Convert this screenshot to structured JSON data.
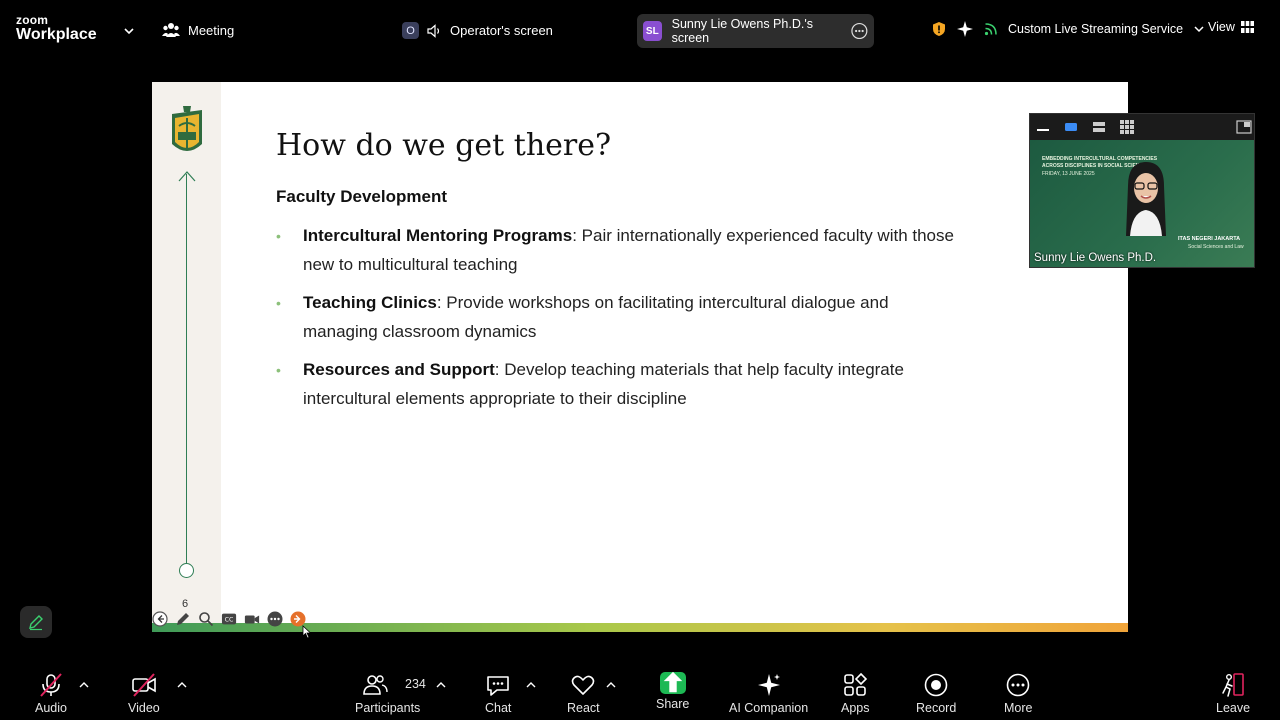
{
  "app": {
    "logo_line1": "zoom",
    "logo_line2": "Workplace"
  },
  "topbar": {
    "meeting_label": "Meeting",
    "operator_badge": "O",
    "operator_label": "Operator's screen",
    "speaker_badge": "SL",
    "speaker_label": "Sunny Lie Owens Ph.D.'s screen",
    "streaming_label": "Custom Live Streaming Service",
    "view_label": "View"
  },
  "slide": {
    "title": "How do we get there?",
    "section": "Faculty Development",
    "bullets": [
      {
        "bold": "Intercultural Mentoring Programs",
        "text": ": Pair internationally experienced faculty with those new to multicultural teaching"
      },
      {
        "bold": "Teaching Clinics",
        "text": ": Provide workshops on facilitating intercultural dialogue and managing classroom dynamics"
      },
      {
        "bold": "Resources and Support",
        "text": ": Develop teaching materials that help faculty integrate intercultural elements appropriate to their discipline"
      }
    ],
    "page_number": "6"
  },
  "thumbnail": {
    "name": "Sunny Lie Owens Ph.D.",
    "banner_line1": "EMBEDDING INTERCULTURAL COMPETENCIES",
    "banner_line2": "ACROSS DISCIPLINES IN SOCIAL SCIENCES",
    "banner_date": "FRIDAY, 13 JUNE 2025",
    "banner_univ": "ITAS NEGERI JAKARTA",
    "banner_faculty": "Social Sciences and Law"
  },
  "bottombar": {
    "audio": "Audio",
    "video": "Video",
    "participants": "Participants",
    "participants_count": "234",
    "chat": "Chat",
    "react": "React",
    "share": "Share",
    "ai_companion": "AI Companion",
    "apps": "Apps",
    "record": "Record",
    "more": "More",
    "leave": "Leave"
  },
  "colors": {
    "accent_green": "#2f7e55",
    "share_green": "#1db954",
    "muted_red": "#e0245e"
  }
}
